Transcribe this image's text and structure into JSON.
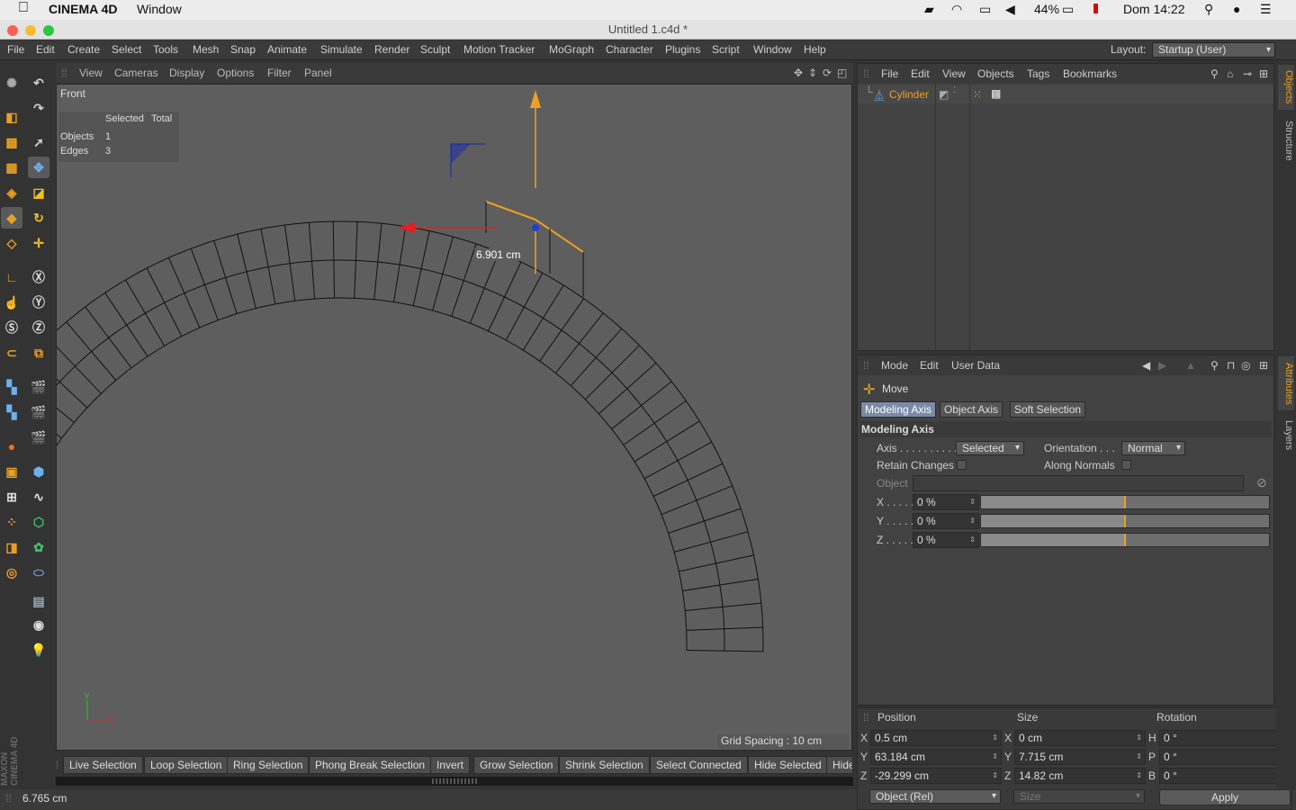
{
  "mac": {
    "app": "CINEMA 4D",
    "menu": "Window",
    "battery": "44%",
    "clock": "Dom 14:22"
  },
  "window": {
    "title": "Untitled 1.c4d *"
  },
  "menubar": {
    "items": [
      "File",
      "Edit",
      "Create",
      "Select",
      "Tools",
      "Mesh",
      "Snap",
      "Animate",
      "Simulate",
      "Render",
      "Sculpt",
      "Motion Tracker",
      "MoGraph",
      "Character",
      "Plugins",
      "Script",
      "Window",
      "Help"
    ],
    "layout_label": "Layout:",
    "layout_value": "Startup (User)"
  },
  "viewport": {
    "menu": [
      "View",
      "Cameras",
      "Display",
      "Options",
      "Filter",
      "Panel"
    ],
    "view_name": "Front",
    "stats": {
      "col_selected": "Selected",
      "col_total": "Total",
      "rows": [
        {
          "label": "Objects",
          "value": "1"
        },
        {
          "label": "Edges",
          "value": "3"
        }
      ]
    },
    "measure": "6.901 cm",
    "grid_spacing": "Grid Spacing : 10 cm",
    "axis_y": "Y",
    "axis_x": "X"
  },
  "selection_bar": {
    "items": [
      "Live Selection",
      "Loop Selection",
      "Ring Selection",
      "Phong Break Selection",
      "Invert",
      "Grow Selection",
      "Shrink Selection",
      "Select Connected",
      "Hide Selected",
      "Hide"
    ]
  },
  "status": {
    "text": "6.765 cm"
  },
  "objects_panel": {
    "menu": [
      "File",
      "Edit",
      "View",
      "Objects",
      "Tags",
      "Bookmarks"
    ],
    "object_name": "Cylinder"
  },
  "attributes_panel": {
    "menu": [
      "Mode",
      "Edit",
      "User Data"
    ],
    "tool": "Move",
    "tabs": [
      "Modeling Axis",
      "Object Axis",
      "Soft Selection"
    ],
    "section": "Modeling Axis",
    "axis_label": "Axis . . . . . . . . . .",
    "axis_value": "Selected",
    "orientation_label": "Orientation . . .",
    "orientation_value": "Normal",
    "retain_label": "Retain Changes",
    "along_label": "Along Normals",
    "object_label": "Object",
    "sliders": [
      {
        "label": "X . . . . .",
        "value": "0 %",
        "level": 0.5
      },
      {
        "label": "Y . . . . .",
        "value": "0 %",
        "level": 0.5
      },
      {
        "label": "Z . . . . .",
        "value": "0 %",
        "level": 0.5
      }
    ]
  },
  "coords": {
    "headers": [
      "Position",
      "Size",
      "Rotation"
    ],
    "position": [
      {
        "axis": "X",
        "value": "0.5 cm"
      },
      {
        "axis": "Y",
        "value": "63.184 cm"
      },
      {
        "axis": "Z",
        "value": "-29.299 cm"
      }
    ],
    "size": [
      {
        "axis": "X",
        "value": "0 cm"
      },
      {
        "axis": "Y",
        "value": "7.715 cm"
      },
      {
        "axis": "Z",
        "value": "14.82 cm"
      }
    ],
    "rotation": [
      {
        "axis": "H",
        "value": "0 °"
      },
      {
        "axis": "P",
        "value": "0 °"
      },
      {
        "axis": "B",
        "value": "0 °"
      }
    ],
    "mode": "Object (Rel)",
    "size_mode": "Size",
    "apply": "Apply"
  },
  "right_tabs": [
    "Objects",
    "Structure",
    "Attributes",
    "Layers"
  ],
  "brand": "MAXON CINEMA 4D",
  "colors": {
    "viewport_bg": "#5e5e5e",
    "accent_orange": "#e8a020",
    "selection_tab": "#7a8ba8",
    "axis_red": "#e02020"
  }
}
